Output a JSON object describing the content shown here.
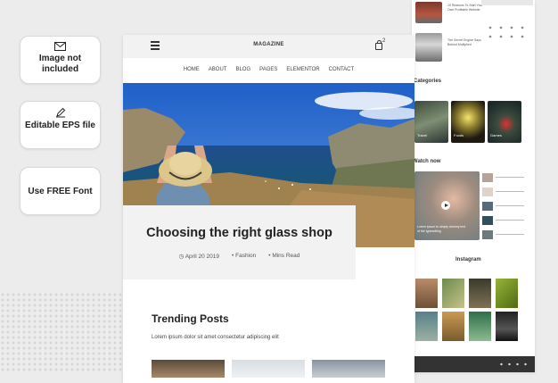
{
  "badges": {
    "no_image": "Image not included",
    "eps": "Editable EPS file",
    "font": "Use FREE Font"
  },
  "header": {
    "logo": "MAGAZINE",
    "cart_count": "2"
  },
  "nav": [
    "HOME",
    "ABOUT",
    "BLOG",
    "PAGES",
    "ELEMENTOR",
    "CONTACT"
  ],
  "post": {
    "title": "Choosing the right glass shop",
    "date": "April 20 2019",
    "category": "Fashion",
    "read": "Mins Read"
  },
  "trending": {
    "heading": "Trending Posts",
    "text": "Lorem ipsum dolor sit amet consectetur adipiscing elit"
  },
  "right": {
    "categories": "Categories",
    "cat_labels": [
      "Travel",
      "Foods",
      "Games"
    ],
    "watch": "Watch now",
    "video_caption": "Lorem ipsum to simply dummy text of the typesetting",
    "instagram": "Instagram"
  },
  "colors": {
    "accent": "#222222",
    "footer": "#333333"
  }
}
